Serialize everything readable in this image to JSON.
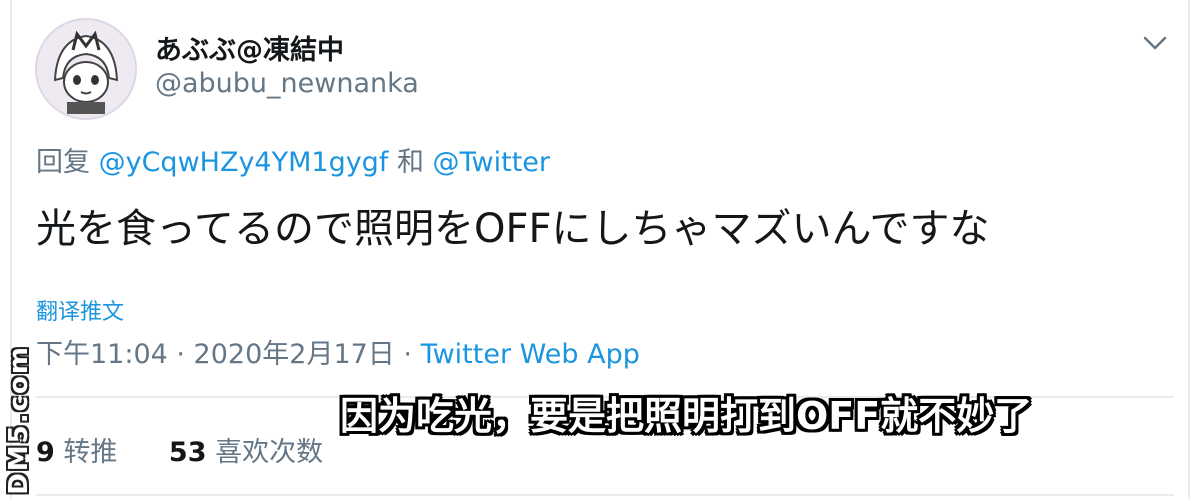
{
  "tweet": {
    "display_name": "あぶぶ@凍結中",
    "handle": "@abubu_newnanka",
    "reply_prefix": "回复",
    "reply_user1": "@yCqwHZy4YM1gygf",
    "reply_and": "和",
    "reply_user2": "@Twitter",
    "text": "光を食ってるので照明をOFFにしちゃマズいんですな",
    "translate_label": "翻译推文",
    "time": "下午11:04 · 2020年2月17日 ·",
    "source": "Twitter Web App",
    "retweet_count": "9",
    "retweet_label": "转推",
    "like_count": "53",
    "like_label": "喜欢次数"
  },
  "overlay": {
    "subtitle": "因为吃光，要是把照明打到OFF就不妙了",
    "watermark": "DM5.com"
  },
  "icons": {
    "avatar": "anime-avatar-icon",
    "menu": "chevron-down-icon"
  },
  "colors": {
    "link": "#1b95e0",
    "secondary": "#657786",
    "primary": "#14171a"
  }
}
